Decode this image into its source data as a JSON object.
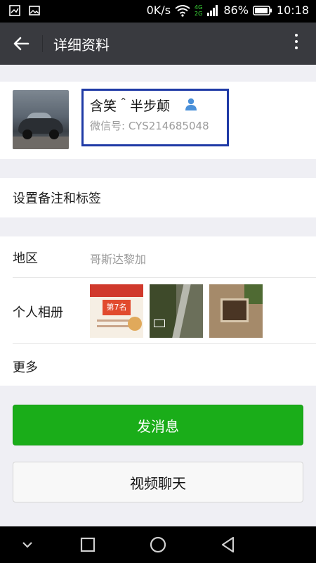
{
  "status_bar": {
    "speed": "0K/s",
    "network_4g": "4G",
    "network_2g": "2G",
    "battery": "86%",
    "time": "10:18"
  },
  "nav": {
    "title": "详细资料"
  },
  "profile": {
    "nickname": "含笑＾半步颠",
    "wechat_id": "微信号: CYS214685048"
  },
  "remark": {
    "label": "设置备注和标签"
  },
  "details": {
    "region_label": "地区",
    "region_value": "哥斯达黎加",
    "album_label": "个人相册",
    "album_1_badge": "第7名",
    "more_label": "更多"
  },
  "actions": {
    "send_message": "发消息",
    "video_chat": "视频聊天"
  },
  "colors": {
    "nav_bg": "#393a3f",
    "primary_green": "#1aad19",
    "highlight_border": "#1f3aa6",
    "page_bg": "#efeff4"
  }
}
